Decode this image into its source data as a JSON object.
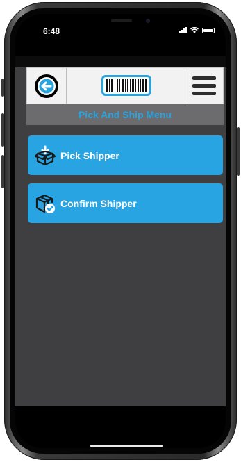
{
  "status_bar": {
    "time": "6:48"
  },
  "header": {
    "back_icon": "arrow-left-icon",
    "scan_icon": "barcode-icon",
    "menu_icon": "hamburger-menu-icon"
  },
  "page": {
    "title": "Pick And Ship Menu"
  },
  "menu": {
    "items": [
      {
        "label": "Pick Shipper",
        "icon": "box-download-icon"
      },
      {
        "label": "Confirm Shipper",
        "icon": "box-check-icon"
      }
    ]
  },
  "colors": {
    "accent": "#2aa3dd",
    "button": "#29a4e3",
    "background": "#3f3f41",
    "title_bar": "#6c6c6e"
  }
}
